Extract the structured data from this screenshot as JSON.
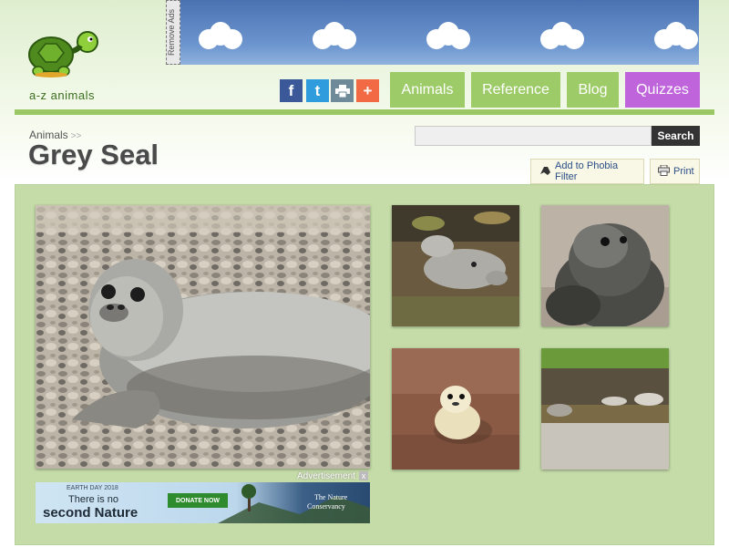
{
  "logo": {
    "text": "a-z animals"
  },
  "banner": {
    "remove_ads_label": "Remove Ads"
  },
  "social": [
    {
      "name": "facebook",
      "glyph": "f",
      "color": "#3b5998"
    },
    {
      "name": "twitter",
      "glyph": "t",
      "color": "#2f9cdd"
    },
    {
      "name": "print",
      "glyph": "",
      "color": "#6f8a99"
    },
    {
      "name": "share-plus",
      "glyph": "+",
      "color": "#f26a43"
    }
  ],
  "nav": [
    {
      "label": "Animals",
      "color": "#9dcb68"
    },
    {
      "label": "Reference",
      "color": "#9dcb68"
    },
    {
      "label": "Blog",
      "color": "#9dcb68"
    },
    {
      "label": "Quizzes",
      "color": "#c064db"
    }
  ],
  "breadcrumb": {
    "label": "Animals",
    "sep": ">>"
  },
  "page": {
    "title": "Grey Seal"
  },
  "search": {
    "placeholder": "",
    "value": "",
    "button_label": "Search"
  },
  "tools": {
    "phobia_label": "Add to Phobia Filter",
    "print_label": "Print"
  },
  "ad": {
    "label": "Advertisement",
    "close_glyph": "x",
    "earth_day": "EARTH DAY 2018",
    "line1": "There is no",
    "line2": "second Nature",
    "donate": "DONATE NOW",
    "brand_line1": "The Nature",
    "brand_line2": "Conservancy"
  }
}
